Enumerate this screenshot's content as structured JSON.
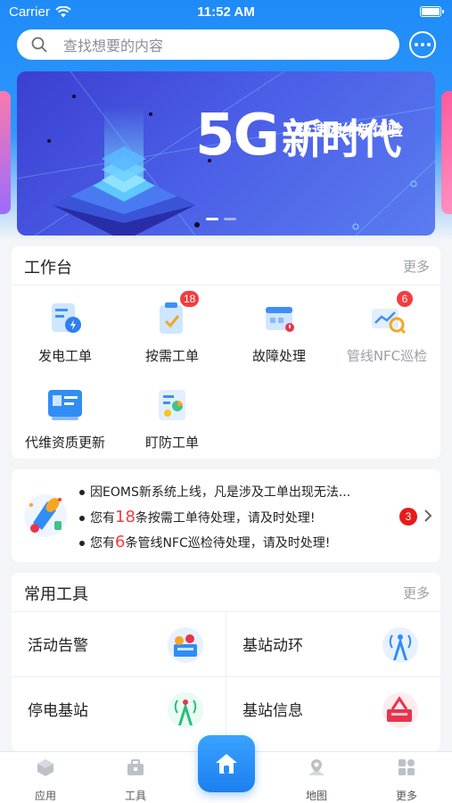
{
  "status_bar": {
    "carrier": "Carrier",
    "time": "11:52 AM"
  },
  "search": {
    "placeholder": "查找想要的内容",
    "icon": "search-icon"
  },
  "banner": {
    "headline_5g": "5G",
    "headline_new_era": "新时代",
    "subtitle": "极速网络新体验",
    "page_count": 2,
    "active_page": 1
  },
  "workbench": {
    "title": "工作台",
    "more": "更多",
    "items": [
      {
        "label": "发电工单",
        "icon": "power-order-icon",
        "badge": ""
      },
      {
        "label": "按需工单",
        "icon": "on-demand-order-icon",
        "badge": "18"
      },
      {
        "label": "故障处理",
        "icon": "fault-handling-icon",
        "badge": ""
      },
      {
        "label": "管线NFC巡检",
        "icon": "nfc-inspection-icon",
        "badge": "6"
      },
      {
        "label": "代维资质更新",
        "icon": "qualification-update-icon",
        "badge": ""
      },
      {
        "label": "盯防工单",
        "icon": "watch-order-icon",
        "badge": ""
      }
    ]
  },
  "notice": {
    "line1": "因EOMS新系统上线，凡是涉及工单出现无法...",
    "line2_prefix": "您有",
    "line2_num": "18",
    "line2_suffix": "条按需工单待处理，请及时处理!",
    "line3_prefix": "您有",
    "line3_num": "6",
    "line3_suffix": "条管线NFC巡检待处理，请及时处理!",
    "badge": "3"
  },
  "tools": {
    "title": "常用工具",
    "more": "更多",
    "items": [
      {
        "label": "活动告警",
        "icon": "active-alarm-icon"
      },
      {
        "label": "基站动环",
        "icon": "base-station-env-icon"
      },
      {
        "label": "停电基站",
        "icon": "power-outage-station-icon"
      },
      {
        "label": "基站信息",
        "icon": "base-station-info-icon"
      }
    ]
  },
  "tabbar": {
    "items": [
      {
        "label": "应用",
        "icon": "apps-icon"
      },
      {
        "label": "工具",
        "icon": "toolbox-icon"
      },
      {
        "label": "",
        "icon": "home-icon"
      },
      {
        "label": "地图",
        "icon": "map-icon"
      },
      {
        "label": "更多",
        "icon": "more-grid-icon"
      }
    ]
  },
  "colors": {
    "primary": "#1f8bf7",
    "badge_red": "#f23d3d",
    "muted": "#9aa0a8"
  }
}
